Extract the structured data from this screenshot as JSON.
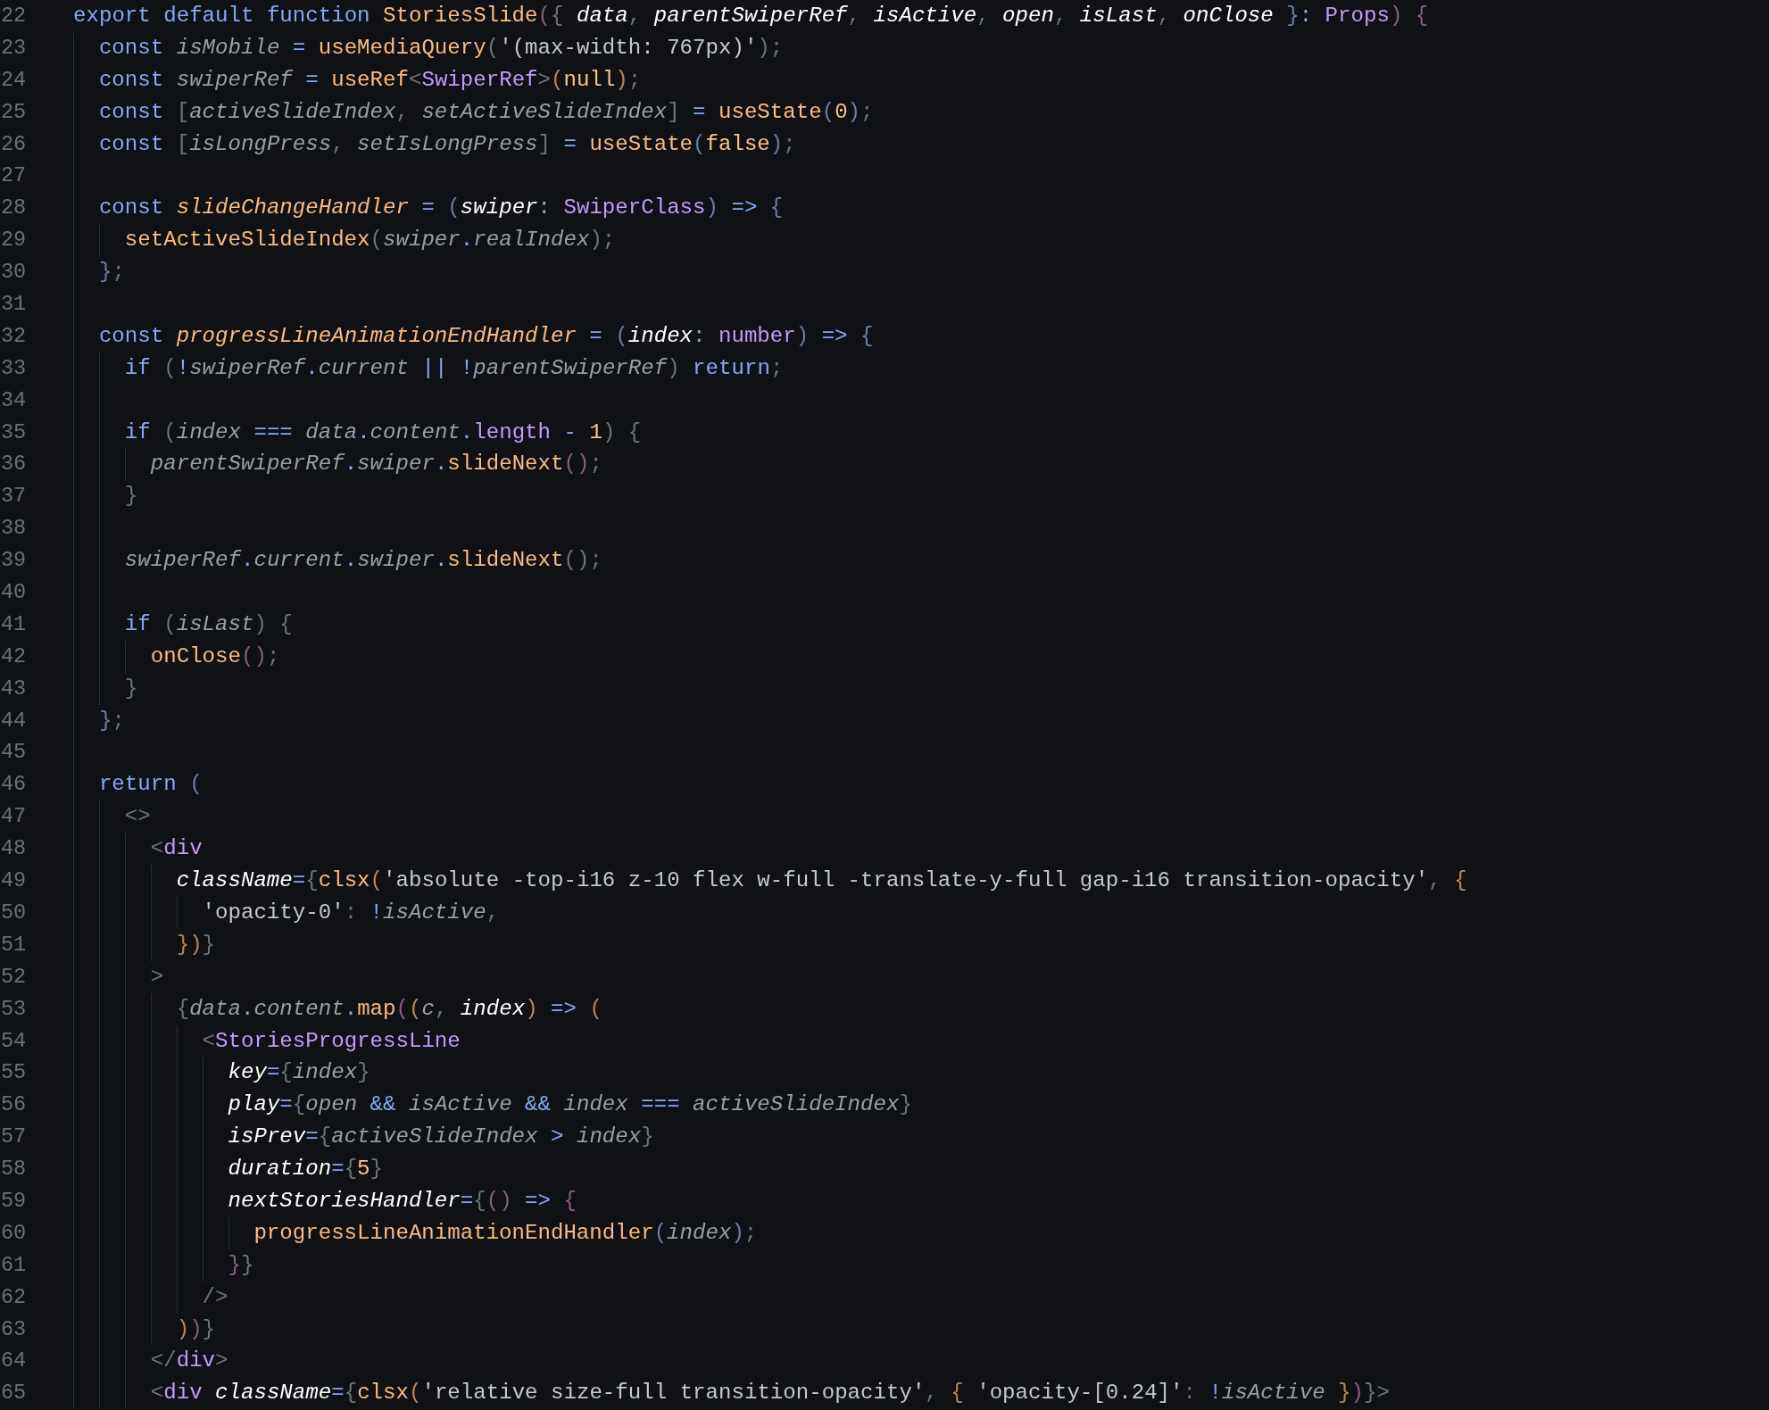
{
  "editor": {
    "lines": [
      {
        "number": "22",
        "tokens": [
          {
            "text": "export default function ",
            "kind": "k"
          },
          {
            "text": "StoriesSlide",
            "kind": "f"
          },
          {
            "text": "(",
            "kind": "b1"
          },
          {
            "text": "{ ",
            "kind": "u"
          },
          {
            "text": "data",
            "kind": "p"
          },
          {
            "text": ", ",
            "kind": "u"
          },
          {
            "text": "parentSwiperRef",
            "kind": "p"
          },
          {
            "text": ", ",
            "kind": "u"
          },
          {
            "text": "isActive",
            "kind": "p"
          },
          {
            "text": ", ",
            "kind": "u"
          },
          {
            "text": "open",
            "kind": "p"
          },
          {
            "text": ", ",
            "kind": "u"
          },
          {
            "text": "isLast",
            "kind": "p"
          },
          {
            "text": ", ",
            "kind": "u"
          },
          {
            "text": "onClose ",
            "kind": "p"
          },
          {
            "text": "}",
            "kind": "b3"
          },
          {
            "text": ": ",
            "kind": "o"
          },
          {
            "text": "Props",
            "kind": "t"
          },
          {
            "text": ")",
            "kind": "b1"
          },
          {
            "text": " {",
            "kind": "b1"
          }
        ],
        "children": [
          {
            "number": "23",
            "tokens": [
              {
                "text": "const ",
                "kind": "k"
              },
              {
                "text": "isMobile",
                "kind": "v"
              },
              {
                "text": " = ",
                "kind": "o"
              },
              {
                "text": "useMediaQuery",
                "kind": "f"
              },
              {
                "text": "(",
                "kind": "u"
              },
              {
                "text": "'(max-width: 767px)'",
                "kind": "s"
              },
              {
                "text": ");",
                "kind": "u"
              }
            ]
          },
          {
            "number": "24",
            "tokens": [
              {
                "text": "const ",
                "kind": "k"
              },
              {
                "text": "swiperRef",
                "kind": "v"
              },
              {
                "text": " = ",
                "kind": "o"
              },
              {
                "text": "useRef",
                "kind": "f"
              },
              {
                "text": "<",
                "kind": "u"
              },
              {
                "text": "SwiperRef",
                "kind": "t"
              },
              {
                "text": ">",
                "kind": "u"
              },
              {
                "text": "(",
                "kind": "b2"
              },
              {
                "text": "null",
                "kind": "n"
              },
              {
                "text": ")",
                "kind": "b2"
              },
              {
                "text": ";",
                "kind": "u"
              }
            ]
          },
          {
            "number": "25",
            "tokens": [
              {
                "text": "const ",
                "kind": "k"
              },
              {
                "text": "[",
                "kind": "u"
              },
              {
                "text": "activeSlideIndex",
                "kind": "v"
              },
              {
                "text": ", ",
                "kind": "u"
              },
              {
                "text": "setActiveSlideIndex",
                "kind": "v"
              },
              {
                "text": "]",
                "kind": "u"
              },
              {
                "text": " = ",
                "kind": "o"
              },
              {
                "text": "useState",
                "kind": "f"
              },
              {
                "text": "(",
                "kind": "b3"
              },
              {
                "text": "0",
                "kind": "n"
              },
              {
                "text": ")",
                "kind": "b3"
              },
              {
                "text": ";",
                "kind": "u"
              }
            ]
          },
          {
            "number": "26",
            "tokens": [
              {
                "text": "const ",
                "kind": "k"
              },
              {
                "text": "[",
                "kind": "u"
              },
              {
                "text": "isLongPress",
                "kind": "v"
              },
              {
                "text": ", ",
                "kind": "u"
              },
              {
                "text": "setIsLongPress",
                "kind": "v"
              },
              {
                "text": "]",
                "kind": "u"
              },
              {
                "text": " = ",
                "kind": "o"
              },
              {
                "text": "useState",
                "kind": "f"
              },
              {
                "text": "(",
                "kind": "b3"
              },
              {
                "text": "false",
                "kind": "n"
              },
              {
                "text": ")",
                "kind": "b3"
              },
              {
                "text": ";",
                "kind": "u"
              }
            ]
          },
          {
            "number": "27"
          },
          {
            "number": "28",
            "tokens": [
              {
                "text": "const ",
                "kind": "k"
              },
              {
                "text": "slideChangeHandler",
                "kind": "fi"
              },
              {
                "text": " = ",
                "kind": "o"
              },
              {
                "text": "(",
                "kind": "b3"
              },
              {
                "text": "swiper",
                "kind": "p"
              },
              {
                "text": ": ",
                "kind": "o"
              },
              {
                "text": "SwiperClass",
                "kind": "t"
              },
              {
                "text": ")",
                "kind": "b3"
              },
              {
                "text": " => ",
                "kind": "o"
              },
              {
                "text": "{",
                "kind": "b3"
              }
            ],
            "children": [
              {
                "number": "29",
                "tokens": [
                  {
                    "text": "setActiveSlideIndex",
                    "kind": "f"
                  },
                  {
                    "text": "(",
                    "kind": "u"
                  },
                  {
                    "text": "swiper",
                    "kind": "v"
                  },
                  {
                    "text": ".",
                    "kind": "o"
                  },
                  {
                    "text": "realIndex",
                    "kind": "v"
                  },
                  {
                    "text": ");",
                    "kind": "u"
                  }
                ]
              }
            ]
          },
          {
            "number": "30",
            "tokens": [
              {
                "text": "}",
                "kind": "b3"
              },
              {
                "text": ";",
                "kind": "u"
              }
            ]
          },
          {
            "number": "31"
          },
          {
            "number": "32",
            "tokens": [
              {
                "text": "const ",
                "kind": "k"
              },
              {
                "text": "progressLineAnimationEndHandler",
                "kind": "fi"
              },
              {
                "text": " = ",
                "kind": "o"
              },
              {
                "text": "(",
                "kind": "b3"
              },
              {
                "text": "index",
                "kind": "p"
              },
              {
                "text": ": ",
                "kind": "o"
              },
              {
                "text": "number",
                "kind": "t"
              },
              {
                "text": ")",
                "kind": "b3"
              },
              {
                "text": " => ",
                "kind": "o"
              },
              {
                "text": "{",
                "kind": "b3"
              }
            ],
            "children": [
              {
                "number": "33",
                "tokens": [
                  {
                    "text": "if ",
                    "kind": "k"
                  },
                  {
                    "text": "(",
                    "kind": "u"
                  },
                  {
                    "text": "!",
                    "kind": "o"
                  },
                  {
                    "text": "swiperRef",
                    "kind": "v"
                  },
                  {
                    "text": ".",
                    "kind": "o"
                  },
                  {
                    "text": "current",
                    "kind": "v"
                  },
                  {
                    "text": " || ",
                    "kind": "o"
                  },
                  {
                    "text": "!",
                    "kind": "o"
                  },
                  {
                    "text": "parentSwiperRef",
                    "kind": "v"
                  },
                  {
                    "text": ") ",
                    "kind": "u"
                  },
                  {
                    "text": "return",
                    "kind": "k"
                  },
                  {
                    "text": ";",
                    "kind": "u"
                  }
                ]
              },
              {
                "number": "34"
              },
              {
                "number": "35",
                "tokens": [
                  {
                    "text": "if ",
                    "kind": "k"
                  },
                  {
                    "text": "(",
                    "kind": "u"
                  },
                  {
                    "text": "index",
                    "kind": "v"
                  },
                  {
                    "text": " === ",
                    "kind": "o"
                  },
                  {
                    "text": "data",
                    "kind": "v"
                  },
                  {
                    "text": ".",
                    "kind": "o"
                  },
                  {
                    "text": "content",
                    "kind": "v"
                  },
                  {
                    "text": ".",
                    "kind": "o"
                  },
                  {
                    "text": "length",
                    "kind": "x"
                  },
                  {
                    "text": " - ",
                    "kind": "o"
                  },
                  {
                    "text": "1",
                    "kind": "n"
                  },
                  {
                    "text": ") {",
                    "kind": "u"
                  }
                ],
                "children": [
                  {
                    "number": "36",
                    "tokens": [
                      {
                        "text": "parentSwiperRef",
                        "kind": "v"
                      },
                      {
                        "text": ".",
                        "kind": "o"
                      },
                      {
                        "text": "swiper",
                        "kind": "v"
                      },
                      {
                        "text": ".",
                        "kind": "o"
                      },
                      {
                        "text": "slideNext",
                        "kind": "f"
                      },
                      {
                        "text": "()",
                        "kind": "b1"
                      },
                      {
                        "text": ";",
                        "kind": "u"
                      }
                    ]
                  }
                ]
              },
              {
                "number": "37",
                "tokens": [
                  {
                    "text": "}",
                    "kind": "u"
                  }
                ]
              },
              {
                "number": "38"
              },
              {
                "number": "39",
                "tokens": [
                  {
                    "text": "swiperRef",
                    "kind": "v"
                  },
                  {
                    "text": ".",
                    "kind": "o"
                  },
                  {
                    "text": "current",
                    "kind": "v"
                  },
                  {
                    "text": ".",
                    "kind": "o"
                  },
                  {
                    "text": "swiper",
                    "kind": "v"
                  },
                  {
                    "text": ".",
                    "kind": "o"
                  },
                  {
                    "text": "slideNext",
                    "kind": "f"
                  },
                  {
                    "text": "();",
                    "kind": "u"
                  }
                ]
              },
              {
                "number": "40"
              },
              {
                "number": "41",
                "tokens": [
                  {
                    "text": "if ",
                    "kind": "k"
                  },
                  {
                    "text": "(",
                    "kind": "u"
                  },
                  {
                    "text": "isLast",
                    "kind": "v"
                  },
                  {
                    "text": ") {",
                    "kind": "u"
                  }
                ],
                "children": [
                  {
                    "number": "42",
                    "tokens": [
                      {
                        "text": "onClose",
                        "kind": "f"
                      },
                      {
                        "text": "()",
                        "kind": "b1"
                      },
                      {
                        "text": ";",
                        "kind": "u"
                      }
                    ]
                  }
                ]
              },
              {
                "number": "43",
                "tokens": [
                  {
                    "text": "}",
                    "kind": "u"
                  }
                ]
              }
            ]
          },
          {
            "number": "44",
            "tokens": [
              {
                "text": "}",
                "kind": "b3"
              },
              {
                "text": ";",
                "kind": "u"
              }
            ]
          },
          {
            "number": "45"
          },
          {
            "number": "46",
            "tokens": [
              {
                "text": "return ",
                "kind": "k"
              },
              {
                "text": "(",
                "kind": "b3"
              }
            ],
            "children": [
              {
                "number": "47",
                "tokens": [
                  {
                    "text": "<>",
                    "kind": "g"
                  }
                ],
                "children": [
                  {
                    "number": "48",
                    "tokens": [
                      {
                        "text": "<",
                        "kind": "g"
                      },
                      {
                        "text": "div",
                        "kind": "t"
                      }
                    ],
                    "children": [
                      {
                        "number": "49",
                        "tokens": [
                          {
                            "text": "className",
                            "kind": "a"
                          },
                          {
                            "text": "=",
                            "kind": "o"
                          },
                          {
                            "text": "{",
                            "kind": "u"
                          },
                          {
                            "text": "clsx",
                            "kind": "f"
                          },
                          {
                            "text": "(",
                            "kind": "b2"
                          },
                          {
                            "text": "'absolute -top-i16 z-10 flex w-full -translate-y-full gap-i16 transition-opacity'",
                            "kind": "s"
                          },
                          {
                            "text": ", ",
                            "kind": "u"
                          },
                          {
                            "text": "{",
                            "kind": "b2"
                          }
                        ],
                        "children": [
                          {
                            "number": "50",
                            "tokens": [
                              {
                                "text": "'opacity-0'",
                                "kind": "s"
                              },
                              {
                                "text": ": ",
                                "kind": "u"
                              },
                              {
                                "text": "!",
                                "kind": "o"
                              },
                              {
                                "text": "isActive",
                                "kind": "v"
                              },
                              {
                                "text": ",",
                                "kind": "u"
                              }
                            ]
                          }
                        ]
                      },
                      {
                        "number": "51",
                        "tokens": [
                          {
                            "text": "}",
                            "kind": "b2"
                          },
                          {
                            "text": ")",
                            "kind": "b2"
                          },
                          {
                            "text": "}",
                            "kind": "u"
                          }
                        ]
                      }
                    ]
                  },
                  {
                    "number": "52",
                    "tokens": [
                      {
                        "text": ">",
                        "kind": "g"
                      }
                    ],
                    "children": [
                      {
                        "number": "53",
                        "tokens": [
                          {
                            "text": "{",
                            "kind": "u"
                          },
                          {
                            "text": "data",
                            "kind": "v"
                          },
                          {
                            "text": ".",
                            "kind": "o"
                          },
                          {
                            "text": "content",
                            "kind": "v"
                          },
                          {
                            "text": ".",
                            "kind": "o"
                          },
                          {
                            "text": "map",
                            "kind": "f"
                          },
                          {
                            "text": "(",
                            "kind": "b1"
                          },
                          {
                            "text": "(",
                            "kind": "b2"
                          },
                          {
                            "text": "c",
                            "kind": "v"
                          },
                          {
                            "text": ", ",
                            "kind": "u"
                          },
                          {
                            "text": "index",
                            "kind": "p"
                          },
                          {
                            "text": ")",
                            "kind": "b2"
                          },
                          {
                            "text": " => ",
                            "kind": "o"
                          },
                          {
                            "text": "(",
                            "kind": "b2"
                          }
                        ],
                        "children": [
                          {
                            "number": "54",
                            "tokens": [
                              {
                                "text": "<",
                                "kind": "g"
                              },
                              {
                                "text": "StoriesProgressLine",
                                "kind": "t"
                              }
                            ],
                            "children": [
                              {
                                "number": "55",
                                "tokens": [
                                  {
                                    "text": "key",
                                    "kind": "a"
                                  },
                                  {
                                    "text": "=",
                                    "kind": "o"
                                  },
                                  {
                                    "text": "{",
                                    "kind": "u"
                                  },
                                  {
                                    "text": "index",
                                    "kind": "v"
                                  },
                                  {
                                    "text": "}",
                                    "kind": "u"
                                  }
                                ]
                              },
                              {
                                "number": "56",
                                "tokens": [
                                  {
                                    "text": "play",
                                    "kind": "a"
                                  },
                                  {
                                    "text": "=",
                                    "kind": "o"
                                  },
                                  {
                                    "text": "{",
                                    "kind": "u"
                                  },
                                  {
                                    "text": "open",
                                    "kind": "v"
                                  },
                                  {
                                    "text": " && ",
                                    "kind": "o"
                                  },
                                  {
                                    "text": "isActive",
                                    "kind": "v"
                                  },
                                  {
                                    "text": " && ",
                                    "kind": "o"
                                  },
                                  {
                                    "text": "index",
                                    "kind": "v"
                                  },
                                  {
                                    "text": " === ",
                                    "kind": "o"
                                  },
                                  {
                                    "text": "activeSlideIndex",
                                    "kind": "v"
                                  },
                                  {
                                    "text": "}",
                                    "kind": "u"
                                  }
                                ]
                              },
                              {
                                "number": "57",
                                "tokens": [
                                  {
                                    "text": "isPrev",
                                    "kind": "a"
                                  },
                                  {
                                    "text": "=",
                                    "kind": "o"
                                  },
                                  {
                                    "text": "{",
                                    "kind": "u"
                                  },
                                  {
                                    "text": "activeSlideIndex",
                                    "kind": "v"
                                  },
                                  {
                                    "text": " > ",
                                    "kind": "o"
                                  },
                                  {
                                    "text": "index",
                                    "kind": "v"
                                  },
                                  {
                                    "text": "}",
                                    "kind": "u"
                                  }
                                ]
                              },
                              {
                                "number": "58",
                                "tokens": [
                                  {
                                    "text": "duration",
                                    "kind": "a"
                                  },
                                  {
                                    "text": "=",
                                    "kind": "o"
                                  },
                                  {
                                    "text": "{",
                                    "kind": "u"
                                  },
                                  {
                                    "text": "5",
                                    "kind": "n"
                                  },
                                  {
                                    "text": "}",
                                    "kind": "u"
                                  }
                                ]
                              },
                              {
                                "number": "59",
                                "tokens": [
                                  {
                                    "text": "nextStoriesHandler",
                                    "kind": "a"
                                  },
                                  {
                                    "text": "=",
                                    "kind": "o"
                                  },
                                  {
                                    "text": "{",
                                    "kind": "u"
                                  },
                                  {
                                    "text": "()",
                                    "kind": "b1"
                                  },
                                  {
                                    "text": " => ",
                                    "kind": "o"
                                  },
                                  {
                                    "text": "{",
                                    "kind": "b1"
                                  }
                                ],
                                "children": [
                                  {
                                    "number": "60",
                                    "tokens": [
                                      {
                                        "text": "progressLineAnimationEndHandler",
                                        "kind": "f"
                                      },
                                      {
                                        "text": "(",
                                        "kind": "b3"
                                      },
                                      {
                                        "text": "index",
                                        "kind": "v"
                                      },
                                      {
                                        "text": ")",
                                        "kind": "b3"
                                      },
                                      {
                                        "text": ";",
                                        "kind": "u"
                                      }
                                    ]
                                  }
                                ]
                              },
                              {
                                "number": "61",
                                "tokens": [
                                  {
                                    "text": "}",
                                    "kind": "b1"
                                  },
                                  {
                                    "text": "}",
                                    "kind": "u"
                                  }
                                ]
                              }
                            ]
                          },
                          {
                            "number": "62",
                            "tokens": [
                              {
                                "text": "/>",
                                "kind": "g"
                              }
                            ]
                          }
                        ]
                      },
                      {
                        "number": "63",
                        "tokens": [
                          {
                            "text": ")",
                            "kind": "b2"
                          },
                          {
                            "text": ")",
                            "kind": "b1"
                          },
                          {
                            "text": "}",
                            "kind": "u"
                          }
                        ]
                      }
                    ]
                  },
                  {
                    "number": "64",
                    "tokens": [
                      {
                        "text": "</",
                        "kind": "g"
                      },
                      {
                        "text": "div",
                        "kind": "t"
                      },
                      {
                        "text": ">",
                        "kind": "g"
                      }
                    ]
                  },
                  {
                    "number": "65",
                    "tokens": [
                      {
                        "text": "<",
                        "kind": "g"
                      },
                      {
                        "text": "div ",
                        "kind": "t"
                      },
                      {
                        "text": "className",
                        "kind": "a"
                      },
                      {
                        "text": "=",
                        "kind": "o"
                      },
                      {
                        "text": "{",
                        "kind": "u"
                      },
                      {
                        "text": "clsx",
                        "kind": "f"
                      },
                      {
                        "text": "(",
                        "kind": "b2"
                      },
                      {
                        "text": "'relative size-full transition-opacity'",
                        "kind": "s"
                      },
                      {
                        "text": ", ",
                        "kind": "u"
                      },
                      {
                        "text": "{ ",
                        "kind": "b2"
                      },
                      {
                        "text": "'opacity-[0.24]'",
                        "kind": "s"
                      },
                      {
                        "text": ": ",
                        "kind": "u"
                      },
                      {
                        "text": "!",
                        "kind": "o"
                      },
                      {
                        "text": "isActive ",
                        "kind": "v"
                      },
                      {
                        "text": "}",
                        "kind": "b2"
                      },
                      {
                        "text": ")",
                        "kind": "b1"
                      },
                      {
                        "text": "}",
                        "kind": "u"
                      },
                      {
                        "text": ">",
                        "kind": "g"
                      }
                    ]
                  }
                ]
              }
            ]
          }
        ]
      }
    ]
  }
}
